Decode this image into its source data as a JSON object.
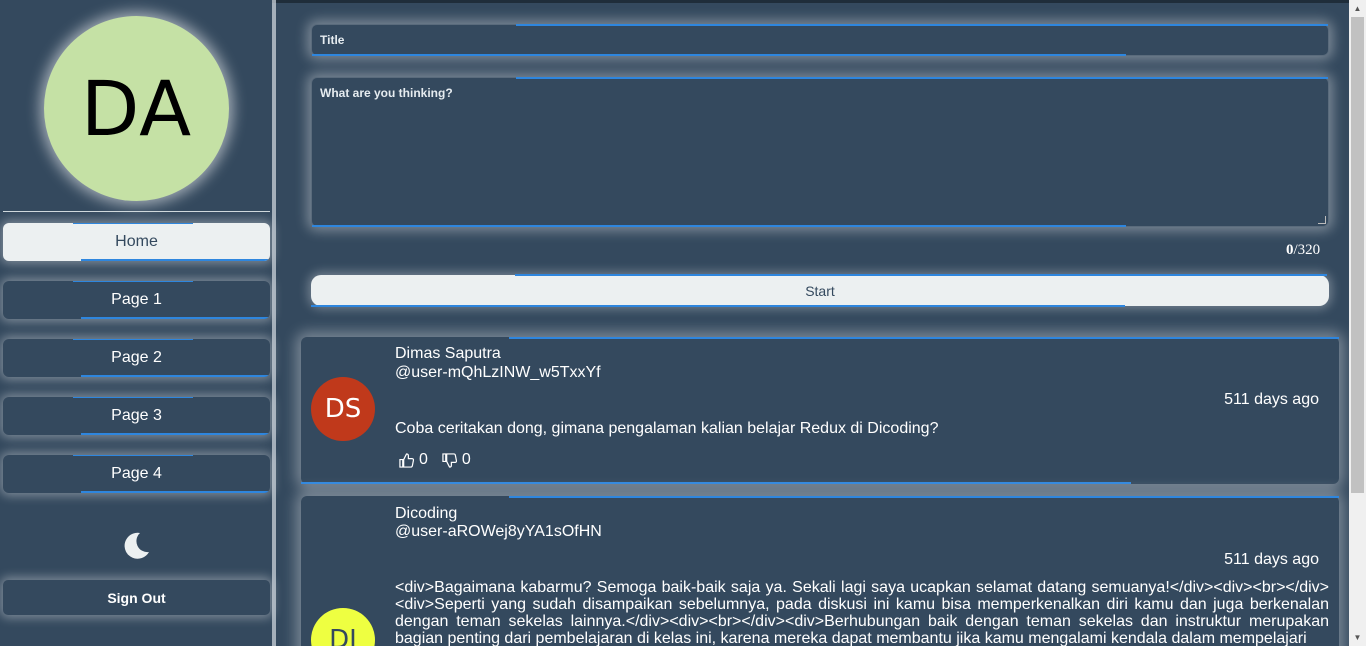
{
  "profile": {
    "initials": "DA"
  },
  "nav": {
    "items": [
      {
        "label": "Home",
        "active": true
      },
      {
        "label": "Page 1"
      },
      {
        "label": "Page 2"
      },
      {
        "label": "Page 3"
      },
      {
        "label": "Page 4"
      }
    ],
    "theme_icon": "moon-icon",
    "signout_label": "Sign Out"
  },
  "composer": {
    "title_placeholder": "Title",
    "body_placeholder": "What are you thinking?",
    "char_count": "0",
    "char_limit": "/320",
    "submit_label": "Start"
  },
  "threads": [
    {
      "initials": "DS",
      "avatar_color": "#c0391b",
      "name": "Dimas Saputra",
      "username": "@user-mQhLzINW_w5TxxYf",
      "time": "511 days ago",
      "body": "Coba ceritakan dong, gimana pengalaman kalian belajar Redux di Dicoding?",
      "upvotes": "0",
      "downvotes": "0"
    },
    {
      "initials": "DI",
      "avatar_color": "#eeff41",
      "name": "Dicoding",
      "username": "@user-aROWej8yYA1sOfHN",
      "time": "511 days ago",
      "body": "<div>Bagaimana kabarmu? Semoga baik-baik saja ya. Sekali lagi saya ucapkan selamat datang semuanya!</div><div><br></div><div>Seperti yang sudah disampaikan sebelumnya, pada diskusi ini kamu bisa memperkenalkan diri kamu dan juga berkenalan dengan teman sekelas lainnya.</div><div><br></div><div>Berhubungan baik dengan teman sekelas dan instruktur merupakan bagian penting dari pembelajaran di kelas ini, karena mereka dapat membantu jika kamu mengalami kendala dalam mempelajari"
    }
  ],
  "colors": {
    "background": "#34495e",
    "accent": "#2e86de",
    "light": "#ecf0f1"
  }
}
